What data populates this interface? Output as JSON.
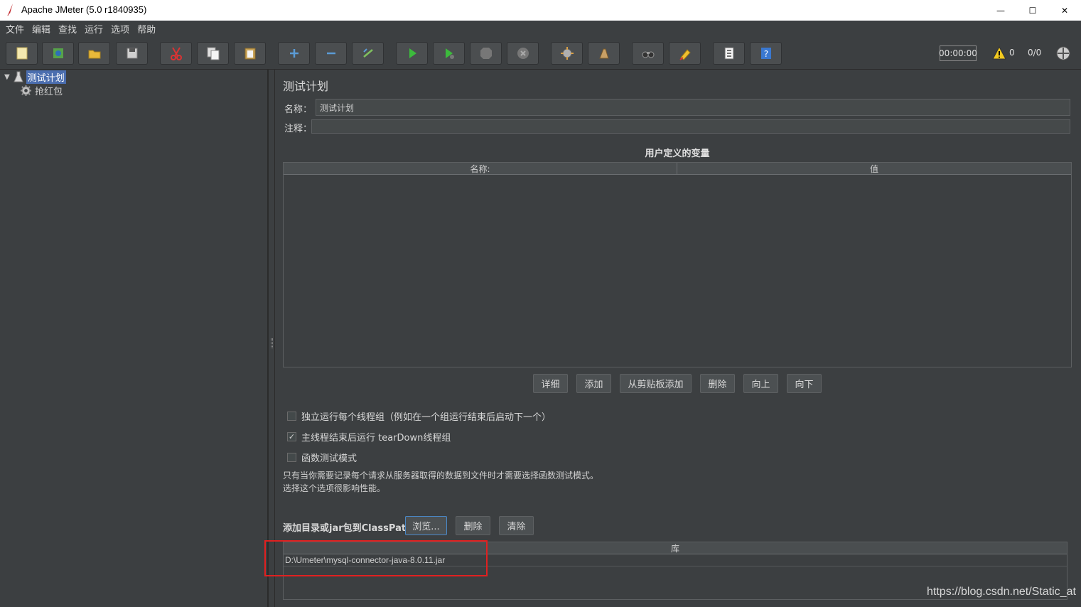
{
  "window": {
    "title": "Apache JMeter (5.0 r1840935)",
    "minimize_glyph": "—",
    "maximize_glyph": "☐",
    "close_glyph": "✕"
  },
  "menu": [
    "文件",
    "编辑",
    "查找",
    "运行",
    "选项",
    "帮助"
  ],
  "toolbar": {
    "buttons": [
      "new-icon",
      "templates-icon",
      "open-icon",
      "save-icon",
      "cut-icon",
      "copy-icon",
      "paste-icon",
      "expand-icon",
      "collapse-icon",
      "toggle-icon",
      "start-icon",
      "start-no-pause-icon",
      "stop-icon",
      "shutdown-icon",
      "clear-icon",
      "clear-all-icon",
      "search-icon",
      "reset-search-icon",
      "function-helper-icon",
      "help-icon"
    ],
    "timer": "00:00:00",
    "warning_count": "0",
    "thread_count": "0/0"
  },
  "tree": {
    "root": "测试计划",
    "child": "抢红包"
  },
  "main": {
    "title": "测试计划",
    "name_label": "名称：",
    "name_value": "测试计划",
    "comment_label": "注释：",
    "comment_value": "",
    "variables_title": "用户定义的变量",
    "variables_columns": [
      "名称:",
      "值"
    ],
    "variables_buttons": [
      "详细",
      "添加",
      "从剪贴板添加",
      "删除",
      "向上",
      "向下"
    ],
    "checkboxes": [
      {
        "label": "独立运行每个线程组（例如在一个组运行结束后启动下一个）",
        "checked": false
      },
      {
        "label": "主线程结束后运行 tearDown线程组",
        "checked": true
      },
      {
        "label": "函数测试模式",
        "checked": false
      }
    ],
    "hint_line1": "只有当你需要记录每个请求从服务器取得的数据到文件时才需要选择函数测试模式。",
    "hint_line2": "选择这个选项很影响性能。",
    "classpath_label": "添加目录或jar包到ClassPath",
    "classpath_buttons": [
      "浏览...",
      "删除",
      "清除"
    ],
    "library_column": "库",
    "library_rows": [
      "D:\\Umeter\\mysql-connector-java-8.0.11.jar"
    ]
  },
  "watermark": "https://blog.csdn.net/Static_at",
  "colors": {
    "background": "#3c3f41",
    "selection": "#4b6eaf",
    "highlight_box": "#e02020"
  }
}
